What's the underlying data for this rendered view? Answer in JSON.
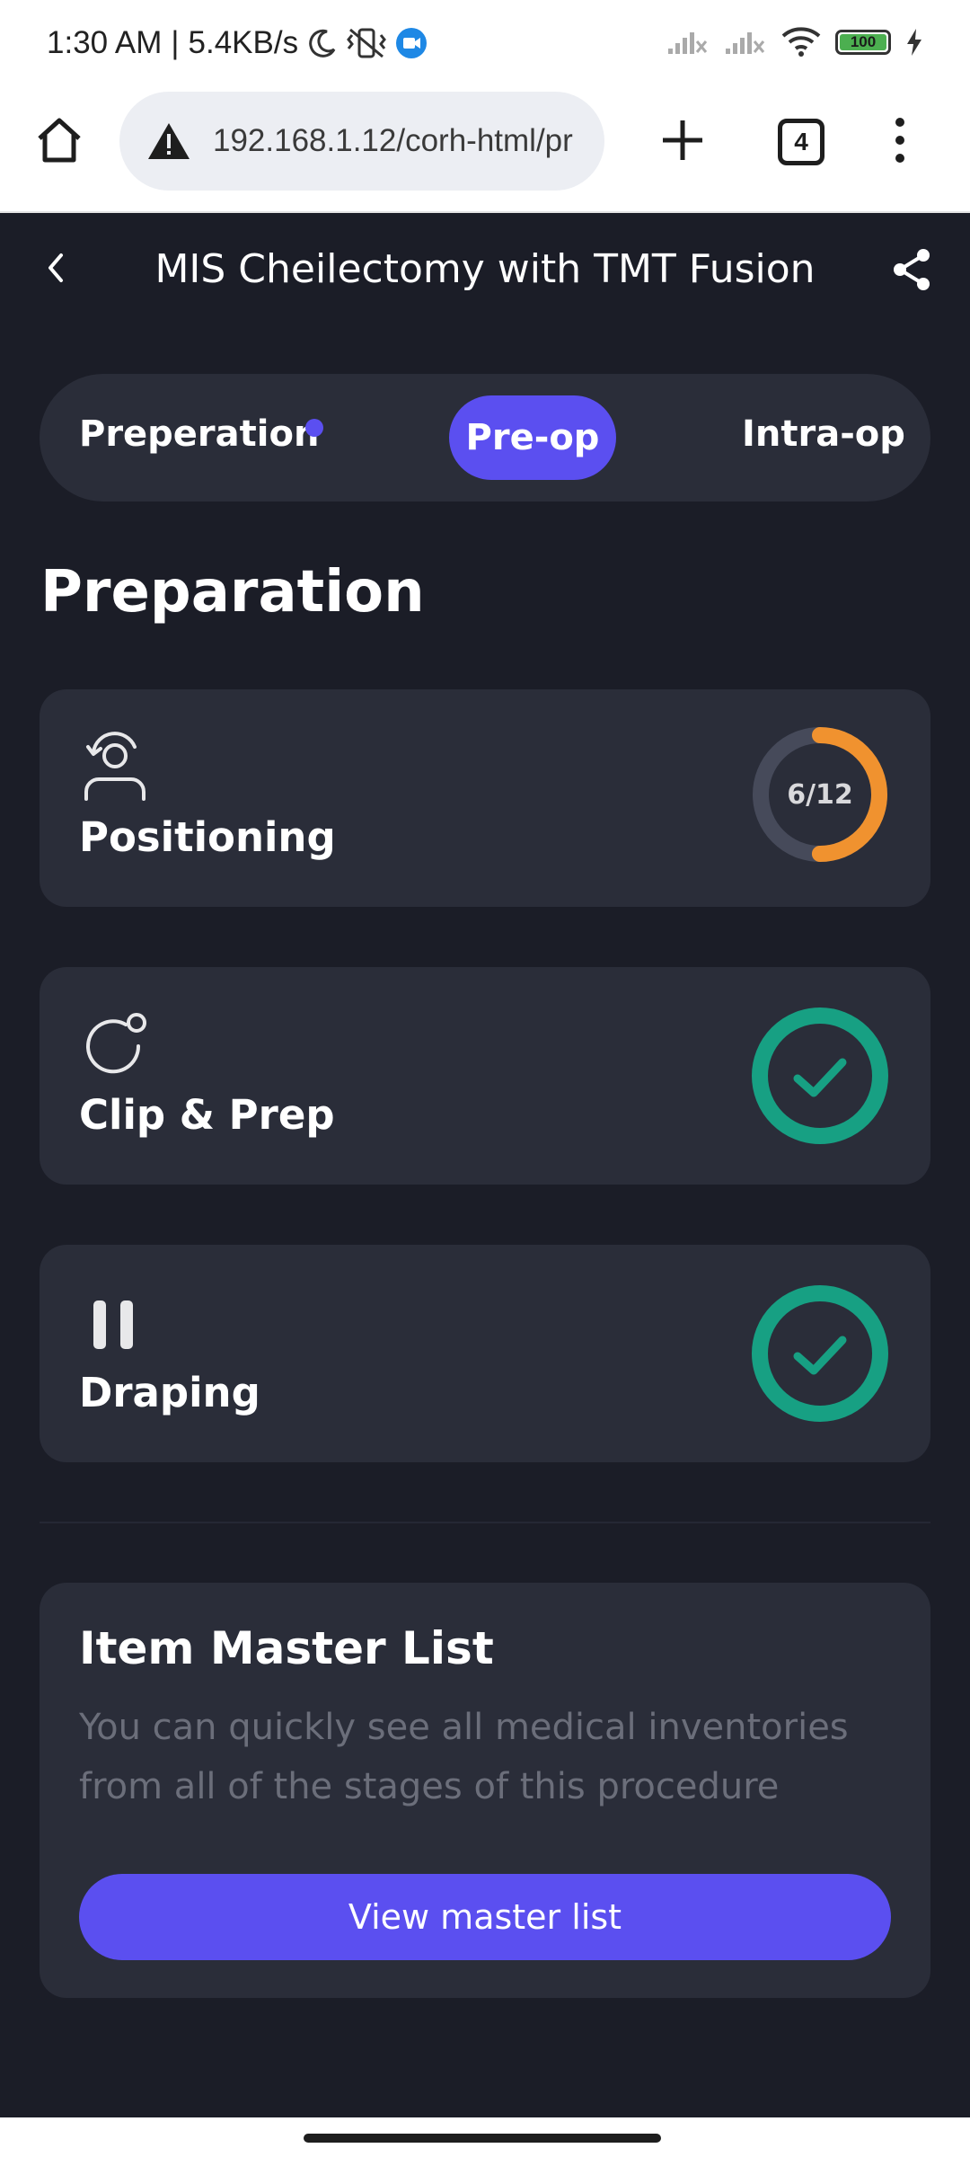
{
  "status_bar": {
    "time": "1:30 AM",
    "network_speed": "5.4KB/s",
    "battery_level": "100",
    "icons": [
      "moon-icon",
      "vibrate-off-icon",
      "video-call-icon",
      "signal-x-icon",
      "signal-x-icon",
      "wifi-icon",
      "battery-icon",
      "charging-icon"
    ]
  },
  "browser": {
    "url": "192.168.1.12/corh-html/pr",
    "tab_count": "4"
  },
  "header": {
    "title": "MIS Cheilectomy with TMT Fusion"
  },
  "stage_tabs": [
    {
      "label": "Preperation",
      "has_dot": true
    },
    {
      "label": "Pre-op",
      "active": true
    },
    {
      "label": "Intra-op"
    }
  ],
  "section_title": "Preparation",
  "steps": [
    {
      "label": "Positioning",
      "icon": "rotate-person-icon",
      "progress_text": "6/12",
      "completed": 6,
      "total": 12
    },
    {
      "label": "Clip & Prep",
      "icon": "clip-icon",
      "completed_state": true
    },
    {
      "label": "Draping",
      "icon": "drape-icon",
      "completed_state": true
    }
  ],
  "master_list": {
    "title": "Item Master List",
    "description": "You can quickly see all medical inventories from all of the stages of this procedure",
    "button_label": "View master list"
  },
  "colors": {
    "background": "#1b1d27",
    "card": "#2a2d39",
    "accent": "#5b4ff0",
    "progress": "#f0922f",
    "success": "#17a083"
  }
}
